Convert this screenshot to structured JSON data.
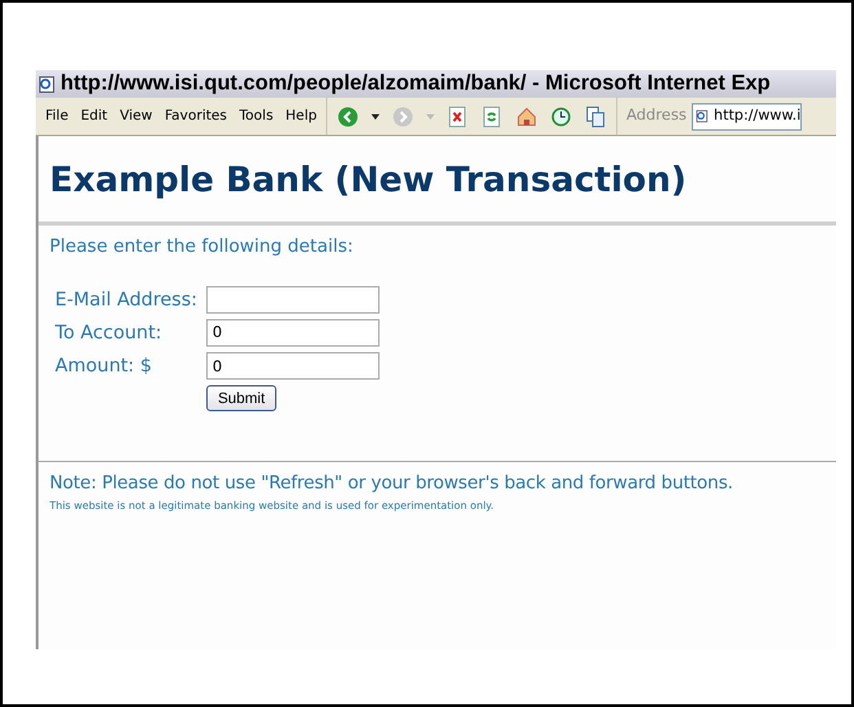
{
  "window": {
    "title": "http://www.isi.qut.com/people/alzomaim/bank/ - Microsoft Internet Exp"
  },
  "menu": [
    "File",
    "Edit",
    "View",
    "Favorites",
    "Tools",
    "Help"
  ],
  "address": {
    "label": "Address",
    "value": "http://www.i"
  },
  "page": {
    "heading": "Example Bank (New Transaction)",
    "intro": "Please enter the following details:",
    "fields": [
      {
        "label": "E-Mail Address:"
      },
      {
        "label": "To Account:",
        "value": "0"
      },
      {
        "label": "Amount: $",
        "value": "0"
      }
    ],
    "submit": "Submit",
    "note": "Note: Please do not use \"Refresh\" or your browser's back and forward buttons.",
    "disclaimer": "This website is not a legitimate banking website and is used for experimentation only."
  }
}
